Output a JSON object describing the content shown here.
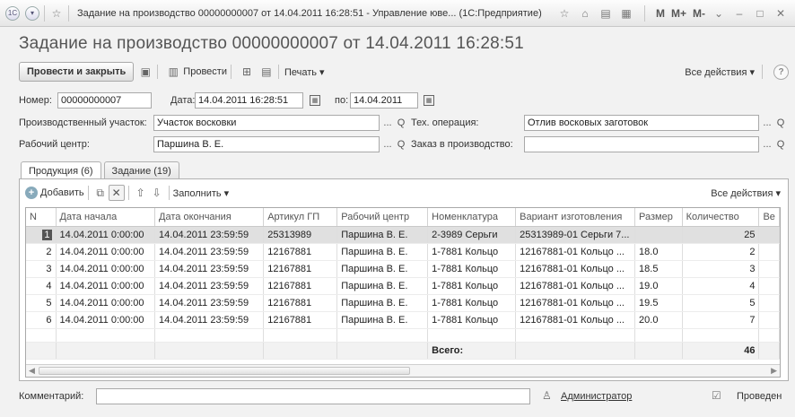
{
  "window": {
    "title": "Задание на производство 00000000007 от 14.04.2011 16:28:51 - Управление юве...  (1С:Предприятие)",
    "m_buttons": [
      "M",
      "M+",
      "M-"
    ]
  },
  "doc_title": "Задание на производство 00000000007 от 14.04.2011 16:28:51",
  "toolbar": {
    "post_and_close": "Провести и закрыть",
    "post": "Провести",
    "print": "Печать ▾",
    "all_actions": "Все действия ▾",
    "help": "?"
  },
  "header": {
    "number_label": "Номер:",
    "number_value": "00000000007",
    "date_label": "Дата:",
    "date_value": "14.04.2011 16:28:51",
    "to_label": "по:",
    "to_value": "14.04.2011",
    "section_label": "Производственный участок:",
    "section_value": "Участок восковки",
    "operation_label": "Тех. операция:",
    "operation_value": "Отлив восковых заготовок",
    "workcenter_label": "Рабочий центр:",
    "workcenter_value": "Паршина В. Е.",
    "order_label": "Заказ в производство:",
    "order_value": "",
    "ellipsis": "...",
    "search": "Q"
  },
  "tabs": [
    "Продукция (6)",
    "Задание (19)"
  ],
  "panel_toolbar": {
    "add": "Добавить",
    "fill": "Заполнить ▾",
    "all_actions": "Все действия ▾"
  },
  "table": {
    "columns": [
      "N",
      "Дата начала",
      "Дата окончания",
      "Артикул ГП",
      "Рабочий центр",
      "Номенклатура",
      "Вариант изготовления",
      "Размер",
      "Количество",
      "Ве"
    ],
    "rows": [
      [
        "1",
        "14.04.2011 0:00:00",
        "14.04.2011 23:59:59",
        "25313989",
        "Паршина В. Е.",
        "2-3989 Серьги",
        "25313989-01 Серьги 7...",
        "",
        "25",
        ""
      ],
      [
        "2",
        "14.04.2011 0:00:00",
        "14.04.2011 23:59:59",
        "12167881",
        "Паршина В. Е.",
        "1-7881 Кольцо",
        "12167881-01 Кольцо ...",
        "18.0",
        "2",
        ""
      ],
      [
        "3",
        "14.04.2011 0:00:00",
        "14.04.2011 23:59:59",
        "12167881",
        "Паршина В. Е.",
        "1-7881 Кольцо",
        "12167881-01 Кольцо ...",
        "18.5",
        "3",
        ""
      ],
      [
        "4",
        "14.04.2011 0:00:00",
        "14.04.2011 23:59:59",
        "12167881",
        "Паршина В. Е.",
        "1-7881 Кольцо",
        "12167881-01 Кольцо ...",
        "19.0",
        "4",
        ""
      ],
      [
        "5",
        "14.04.2011 0:00:00",
        "14.04.2011 23:59:59",
        "12167881",
        "Паршина В. Е.",
        "1-7881 Кольцо",
        "12167881-01 Кольцо ...",
        "19.5",
        "5",
        ""
      ],
      [
        "6",
        "14.04.2011 0:00:00",
        "14.04.2011 23:59:59",
        "12167881",
        "Паршина В. Е.",
        "1-7881 Кольцо",
        "12167881-01 Кольцо ...",
        "20.0",
        "7",
        ""
      ]
    ],
    "total_label": "Всего:",
    "total_value": "46"
  },
  "footer": {
    "comment_label": "Комментарий:",
    "comment_value": "",
    "user": "Администратор",
    "status": "Проведен"
  }
}
